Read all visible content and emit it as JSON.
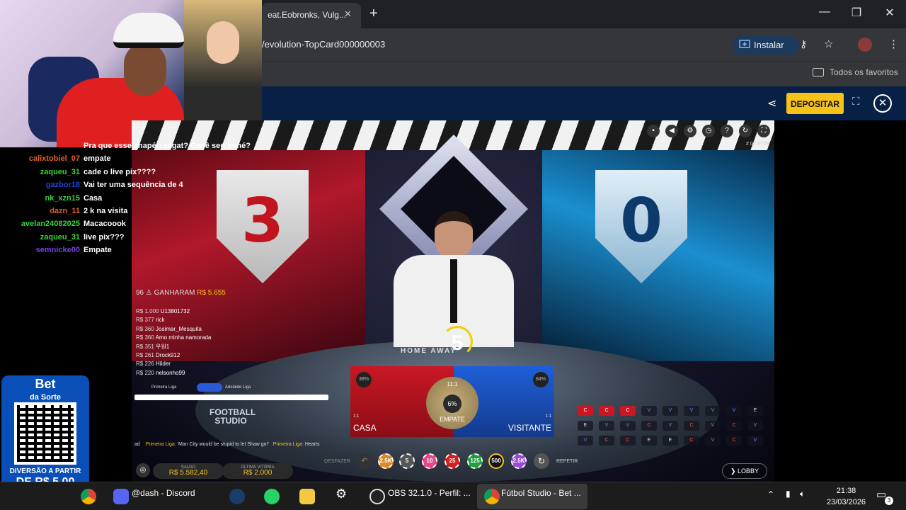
{
  "browser": {
    "tab_title": "eat.Eobronks, Vulg...",
    "url": "/evolution-TopCard000000003",
    "install_label": "Instalar",
    "bookmarks_label": "Todos os favoritos"
  },
  "site": {
    "deposit_label": "DEPOSITAR"
  },
  "game": {
    "home_score": "3",
    "away_score": "0",
    "timer": "5",
    "table_text": "HOME     AWAY",
    "game_time": "# 00:37:59",
    "winners_count": "96",
    "winners_label": "GANHARAM",
    "winners_amount": "R$ 5.655",
    "winners": [
      {
        "amount": "R$ 1.000",
        "name": "U13801732"
      },
      {
        "amount": "R$ 377",
        "name": "rick"
      },
      {
        "amount": "R$ 360",
        "name": "Josimar_Mesquita"
      },
      {
        "amount": "R$ 360",
        "name": "Amo minha namorada"
      },
      {
        "amount": "R$ 351",
        "name": "우원1"
      },
      {
        "amount": "R$ 261",
        "name": "Drock912"
      },
      {
        "amount": "R$ 226",
        "name": "Hilder"
      },
      {
        "amount": "R$ 220",
        "name": "nelsonho99"
      }
    ],
    "league_left": "Primeira Liga",
    "league_right": "Adelaide Liga",
    "studio_logo": "FOOTBALL STUDIO",
    "ticker_league1": "Primeira Liga:",
    "ticker_text1": "'Man City would be stupid to let Shaw go!'",
    "ticker_league2": "Primeira Liga:",
    "ticker_text2": "Hearts",
    "ticker_prefix": "ad",
    "bet_home_label": "CASA",
    "bet_away_label": "VISITANTE",
    "bet_draw_label": "EMPATE",
    "bet_home_pct": "38%",
    "bet_away_pct": "84%",
    "bet_draw_pct": "6%",
    "bet_home_odds": "1:1",
    "bet_away_odds": "1:1",
    "bet_draw_odds": "11:1",
    "history": [
      [
        "C",
        "C",
        "C",
        "V",
        "V",
        "V",
        "V",
        "V",
        "E"
      ],
      [
        "E",
        "V",
        "V",
        "C",
        "V",
        "C",
        "V",
        "C",
        "V"
      ],
      [
        "V",
        "C",
        "C",
        "E",
        "E",
        "C",
        "V",
        "C",
        "V"
      ]
    ],
    "saldo_label": "SALDO",
    "saldo_value": "R$ 5.582,40",
    "last_win_label": "ÚLTIMA VITÓRIA",
    "last_win_value": "R$ 2.000",
    "undo_label": "DESFAZER",
    "repeat_label": "REPETIR",
    "lobby_label": "LOBBY",
    "chips": [
      "2.5K",
      "5",
      "10",
      "25",
      "125",
      "500",
      "2.5K"
    ]
  },
  "chat": [
    {
      "name": "",
      "msg": "Pra que esse chapéu sagat? Cadê seu boné?",
      "color": "#4a7ad8"
    },
    {
      "name": "calixtobiel_07",
      "msg": "empate",
      "color": "#e0602a"
    },
    {
      "name": "zaqueu_31",
      "msg": "cade o live pix????",
      "color": "#3ad43a"
    },
    {
      "name": "gazbor18",
      "msg": "Vai ter uma sequência de 4",
      "color": "#2040e0"
    },
    {
      "name": "nk_xzn15",
      "msg": "Casa",
      "color": "#3ad43a"
    },
    {
      "name": "dazn_11",
      "msg": "2 k na visita",
      "color": "#e0602a"
    },
    {
      "name": "avelan24082025",
      "msg": "Macacoook",
      "color": "#3ad43a"
    },
    {
      "name": "zaqueu_31",
      "msg": "live pix???",
      "color": "#3ad43a"
    },
    {
      "name": "semnicke00",
      "msg": "Empate",
      "color": "#7a40e0"
    }
  ],
  "promo": {
    "brand1": "Bet",
    "brand2": "da Sorte",
    "line1": "DIVERSÃO A PARTIR",
    "line2": "DE R$ 5,00"
  },
  "taskbar": {
    "discord": "@dash - Discord",
    "obs": "OBS 32.1.0 - Perfil: ...",
    "chrome": "Fútbol Studio - Bet ...",
    "time": "21:38",
    "date": "23/03/2026",
    "notif": "3"
  }
}
